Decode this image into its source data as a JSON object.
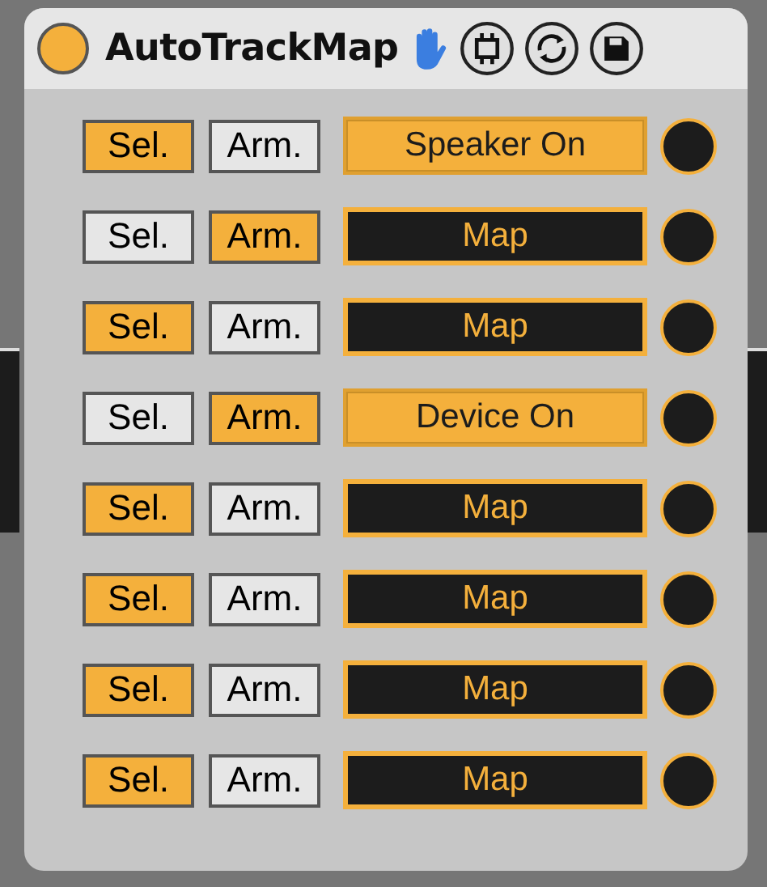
{
  "header": {
    "title": "AutoTrackMap",
    "power_on": true
  },
  "rows": [
    {
      "sel": {
        "label": "Sel.",
        "on": true
      },
      "arm": {
        "label": "Arm.",
        "on": false
      },
      "map": {
        "label": "Speaker On",
        "on": true
      }
    },
    {
      "sel": {
        "label": "Sel.",
        "on": false
      },
      "arm": {
        "label": "Arm.",
        "on": true
      },
      "map": {
        "label": "Map",
        "on": false
      }
    },
    {
      "sel": {
        "label": "Sel.",
        "on": true
      },
      "arm": {
        "label": "Arm.",
        "on": false
      },
      "map": {
        "label": "Map",
        "on": false
      }
    },
    {
      "sel": {
        "label": "Sel.",
        "on": false
      },
      "arm": {
        "label": "Arm.",
        "on": true
      },
      "map": {
        "label": "Device On",
        "on": true
      }
    },
    {
      "sel": {
        "label": "Sel.",
        "on": true
      },
      "arm": {
        "label": "Arm.",
        "on": false
      },
      "map": {
        "label": "Map",
        "on": false
      }
    },
    {
      "sel": {
        "label": "Sel.",
        "on": true
      },
      "arm": {
        "label": "Arm.",
        "on": false
      },
      "map": {
        "label": "Map",
        "on": false
      }
    },
    {
      "sel": {
        "label": "Sel.",
        "on": true
      },
      "arm": {
        "label": "Arm.",
        "on": false
      },
      "map": {
        "label": "Map",
        "on": false
      }
    },
    {
      "sel": {
        "label": "Sel.",
        "on": true
      },
      "arm": {
        "label": "Arm.",
        "on": false
      },
      "map": {
        "label": "Map",
        "on": false
      }
    }
  ]
}
